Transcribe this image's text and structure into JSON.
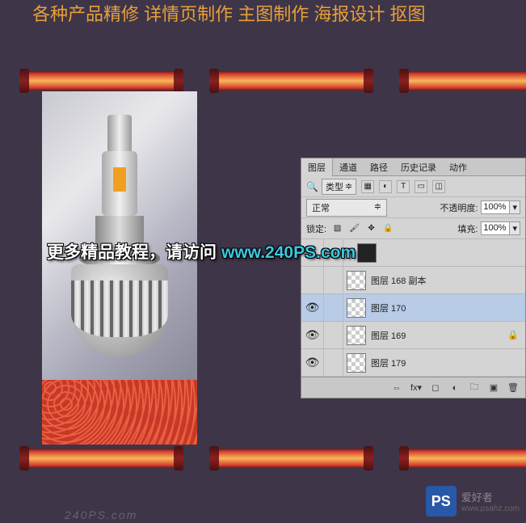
{
  "header_text": "各种产品精修 详情页制作 主图制作 海报设计 抠图",
  "overlay": {
    "text1": "更多精品教程，请访问",
    "text2": "www.240PS.com"
  },
  "panel": {
    "tabs": [
      "图层",
      "通道",
      "路径",
      "历史记录",
      "动作"
    ],
    "type_label": "类型",
    "blend_mode": "正常",
    "opacity_label": "不透明度:",
    "opacity_value": "100%",
    "lock_label": "锁定:",
    "fill_label": "填充:",
    "fill_value": "100%",
    "layers": [
      {
        "name": "",
        "visible": false,
        "thumb": "dark",
        "indent": true,
        "triangle": true
      },
      {
        "name": "图层 168 副本",
        "visible": false,
        "thumb": "checker",
        "indent": true
      },
      {
        "name": "图层 170",
        "visible": true,
        "thumb": "checker",
        "indent": true,
        "selected": true
      },
      {
        "name": "图层 169",
        "visible": true,
        "thumb": "checker",
        "indent": true,
        "locked": true
      },
      {
        "name": "图层 179",
        "visible": true,
        "thumb": "checker",
        "indent": true
      }
    ],
    "footer_fx": "fx"
  },
  "watermark": {
    "ps": "PS",
    "text": "爱好者",
    "url": "www.psahz.com",
    "bottom": "240PS.com"
  }
}
